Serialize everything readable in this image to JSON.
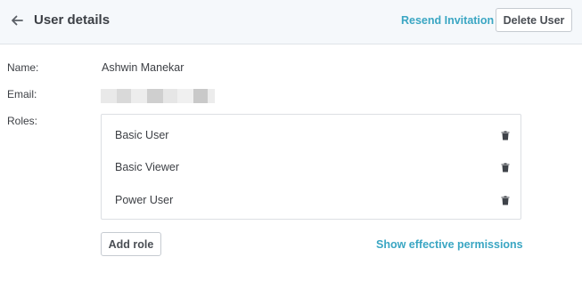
{
  "header": {
    "back_icon": "arrow-left-icon",
    "title": "User details",
    "resend_label": "Resend Invitation",
    "delete_label": "Delete User",
    "background": "#f5f8fb"
  },
  "fields": {
    "name_label": "Name:",
    "name_value": "Ashwin Manekar",
    "email_label": "Email:",
    "email_value_redacted": true,
    "roles_label": "Roles:"
  },
  "roles": [
    {
      "label": "Basic User",
      "delete_icon": "trash-icon"
    },
    {
      "label": "Basic Viewer",
      "delete_icon": "trash-icon"
    },
    {
      "label": "Power User",
      "delete_icon": "trash-icon"
    }
  ],
  "actions": {
    "add_role_label": "Add role",
    "permissions_link": "Show effective permissions"
  },
  "colors": {
    "accent": "#3aa6c3",
    "text": "#3c3f44",
    "border": "#dcdfe3"
  }
}
